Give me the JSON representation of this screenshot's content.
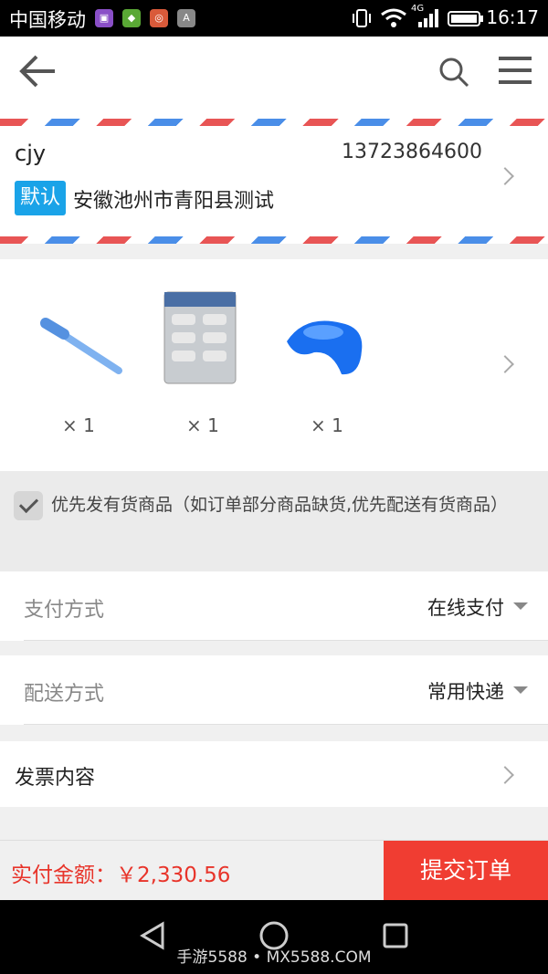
{
  "status_bar": {
    "carrier": "中国移动",
    "network": "4G",
    "time": "16:17"
  },
  "header": {
    "back_icon": "back-arrow-icon",
    "search_icon": "search-icon",
    "menu_icon": "menu-icon"
  },
  "address": {
    "name": "cjy",
    "phone": "13723864600",
    "badge": "默认",
    "text": "安徽池州市青阳县测试"
  },
  "products": [
    {
      "name": "toothbrush",
      "qty": "× 1"
    },
    {
      "name": "blade-pack",
      "qty": "× 1"
    },
    {
      "name": "blue-tray",
      "qty": "× 1"
    }
  ],
  "stock_option": {
    "text": "优先发有货商品（如订单部分商品缺货,优先配送有货商品）",
    "checked": true
  },
  "payment": {
    "label": "支付方式",
    "value": "在线支付"
  },
  "shipping": {
    "label": "配送方式",
    "value": "常用快递"
  },
  "invoice": {
    "label": "发票内容"
  },
  "footer": {
    "total": "实付金额：￥2,330.56",
    "submit": "提交订单"
  },
  "watermark": "手游5588 • MX5588.COM",
  "colors": {
    "accent": "#f03d32",
    "badge": "#1aa3e8"
  }
}
